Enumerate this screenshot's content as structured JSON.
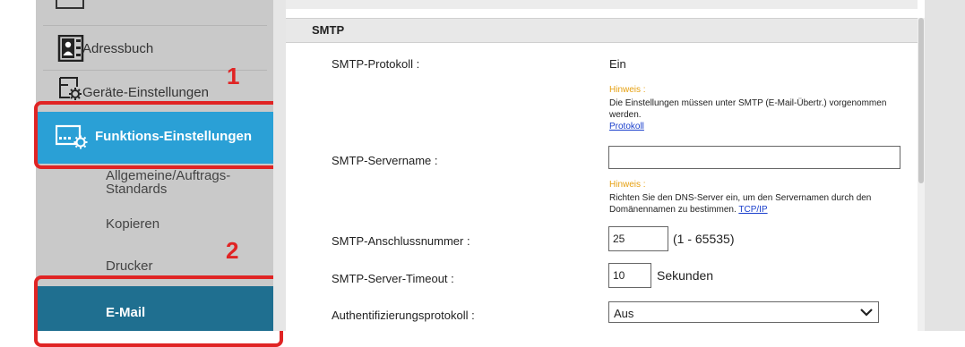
{
  "sidebar": {
    "items": [
      {
        "label": "Adressbuch",
        "icon": "address-book-icon"
      },
      {
        "label": "Geräte-Einstellungen",
        "icon": "device-settings-icon"
      }
    ],
    "active": {
      "label": "Funktions-Einstellungen",
      "icon": "function-settings-icon"
    },
    "subitems": [
      {
        "label": "Allgemeine/Auftrags-Standards"
      },
      {
        "label": "Kopieren"
      },
      {
        "label": "Drucker"
      }
    ],
    "selected_sub": {
      "label": "E-Mail"
    },
    "colors": {
      "active": "#2aa0d6",
      "selected": "#1f6f90",
      "highlight": "#e02424"
    }
  },
  "callouts": {
    "step1": "1",
    "step2": "2"
  },
  "main": {
    "section_title": "SMTP",
    "smtp_protocol": {
      "label": "SMTP-Protokoll :",
      "value": "Ein"
    },
    "hint1": {
      "title": "Hinweis :",
      "text": "Die Einstellungen müssen unter SMTP (E-Mail-Übertr.) vorgenommen werden.",
      "link": "Protokoll"
    },
    "server_name": {
      "label": "SMTP-Servername :",
      "value": ""
    },
    "hint2": {
      "title": "Hinweis :",
      "text": "Richten Sie den DNS-Server ein, um den Servernamen durch den Domänennamen zu bestimmen.",
      "link": "TCP/IP"
    },
    "port": {
      "label": "SMTP-Anschlussnummer :",
      "value": "25",
      "range": "(1 - 65535)"
    },
    "timeout": {
      "label": "SMTP-Server-Timeout :",
      "value": "10",
      "unit": "Sekunden"
    },
    "auth": {
      "label": "Authentifizierungsprotokoll :",
      "value": "Aus"
    }
  }
}
